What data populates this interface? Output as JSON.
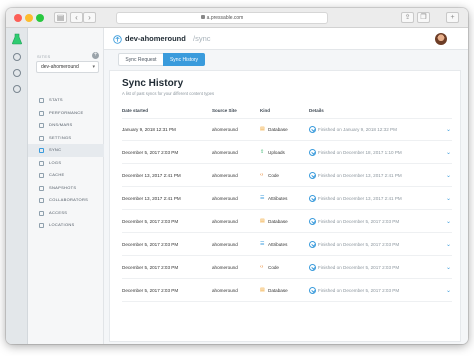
{
  "browser": {
    "url": "a.pressable.com"
  },
  "sidebar": {
    "sites_label": "SITES",
    "selected_site": "dev-ahomeround",
    "items": [
      {
        "label": "STATS",
        "active": false
      },
      {
        "label": "PERFORMANCE",
        "active": false
      },
      {
        "label": "DNS/MARS",
        "active": false
      },
      {
        "label": "SETTINGS",
        "active": false
      },
      {
        "label": "SYNC",
        "active": true
      },
      {
        "label": "LOGS",
        "active": false
      },
      {
        "label": "CACHE",
        "active": false
      },
      {
        "label": "SNAPSHOTS",
        "active": false
      },
      {
        "label": "COLLABORATORS",
        "active": false
      },
      {
        "label": "ACCESS",
        "active": false
      },
      {
        "label": "LOCATIONS",
        "active": false
      }
    ]
  },
  "header": {
    "site": "dev-ahomeround",
    "page": "/sync"
  },
  "tabs": [
    "Sync Request",
    "Sync History"
  ],
  "card": {
    "title": "Sync History",
    "subtitle": "A list of past syncs for your different content types",
    "columns": [
      "Date started",
      "Source Site",
      "Kind",
      "Details"
    ],
    "rows": [
      {
        "date": "January 9, 2018 12:31 PM",
        "site": "ahomeround",
        "kind": "Database",
        "kind_icon": "database-icon",
        "detail": "Finished on January 9, 2018 12:32 PM"
      },
      {
        "date": "December 5, 2017 2:03 PM",
        "site": "ahomeround",
        "kind": "Uploads",
        "kind_icon": "upload-icon",
        "detail": "Finished on December 18, 2017 1:10 PM"
      },
      {
        "date": "December 13, 2017 2:41 PM",
        "site": "ahomeround",
        "kind": "Code",
        "kind_icon": "code-icon",
        "detail": "Finished on December 13, 2017 2:41 PM"
      },
      {
        "date": "December 13, 2017 2:41 PM",
        "site": "ahomeround",
        "kind": "Attributes",
        "kind_icon": "attributes-icon",
        "detail": "Finished on December 13, 2017 2:41 PM"
      },
      {
        "date": "December 5, 2017 2:03 PM",
        "site": "ahomeround",
        "kind": "Database",
        "kind_icon": "database-icon",
        "detail": "Finished on December 5, 2017 2:03 PM"
      },
      {
        "date": "December 5, 2017 2:03 PM",
        "site": "ahomeround",
        "kind": "Attributes",
        "kind_icon": "attributes-icon",
        "detail": "Finished on December 5, 2017 2:03 PM"
      },
      {
        "date": "December 5, 2017 2:03 PM",
        "site": "ahomeround",
        "kind": "Code",
        "kind_icon": "code-icon",
        "detail": "Finished on December 5, 2017 2:03 PM"
      },
      {
        "date": "December 5, 2017 2:03 PM",
        "site": "ahomeround",
        "kind": "Database",
        "kind_icon": "database-icon",
        "detail": "Finished on December 5, 2017 2:03 PM"
      }
    ]
  },
  "colors": {
    "accent": "#3a9bdc",
    "database": "#f0a12a",
    "upload": "#27ae60",
    "code": "#e67e22",
    "attributes": "#3a9bdc"
  }
}
